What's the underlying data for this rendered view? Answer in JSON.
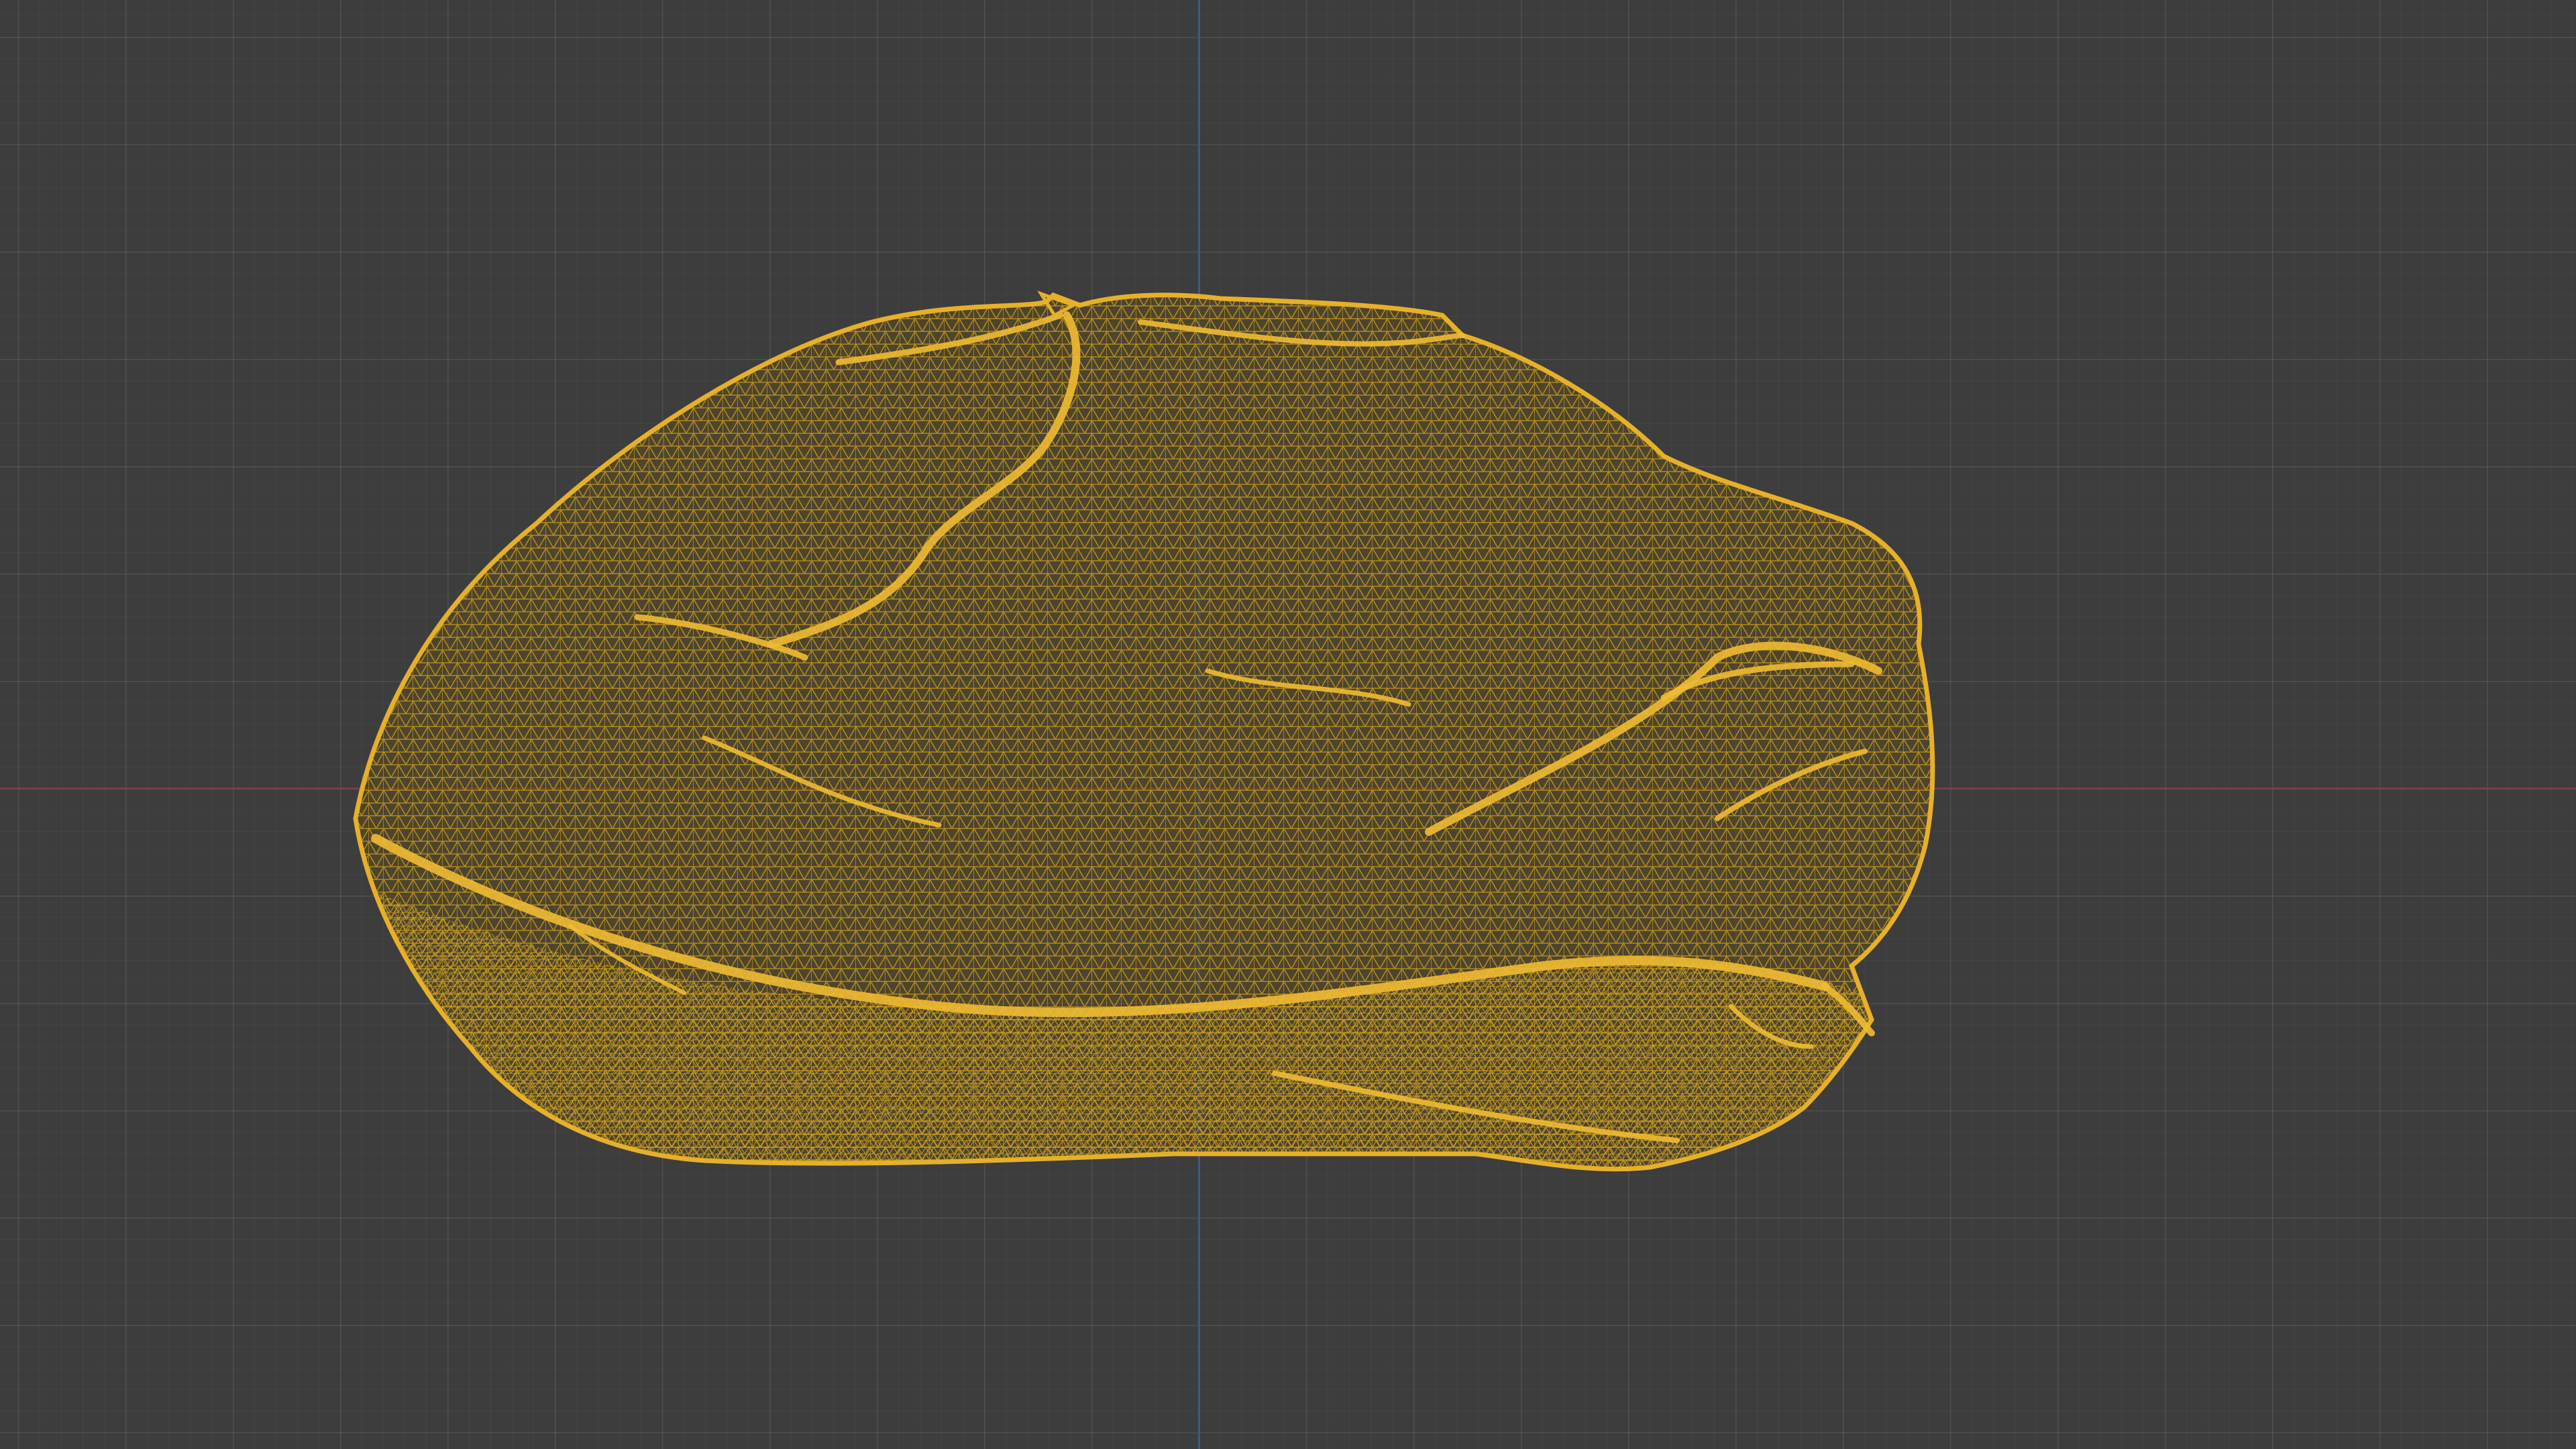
{
  "viewport": {
    "mode": "wireframe",
    "grid": true,
    "background_color": "#3d3d3d",
    "axis_x_color": "#7a3e48",
    "axis_y_color": "#3d5d80",
    "object": {
      "kind": "scanned-rock-mesh",
      "wire_color": "#d4a017"
    }
  }
}
